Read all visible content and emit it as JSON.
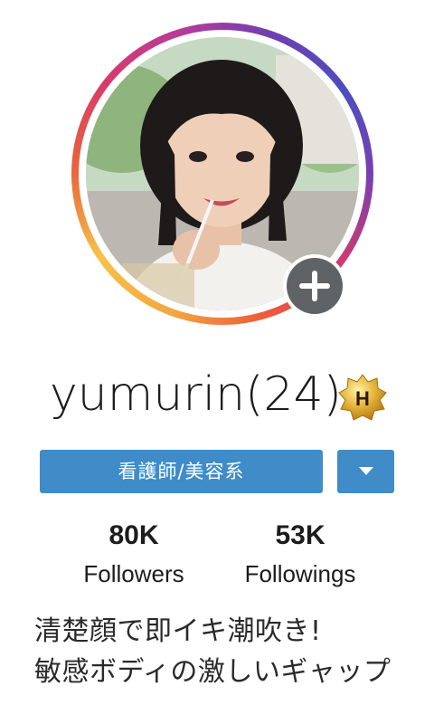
{
  "profile": {
    "username": "yumurin(24)",
    "badge_letter": "H",
    "badge_icon": "gold-star-badge-icon",
    "avatar_icon": "profile-photo",
    "add_icon": "plus-icon"
  },
  "category": {
    "label": "看護師/美容系",
    "dropdown_icon": "caret-down-icon",
    "color": "#3f8cc9"
  },
  "stats": [
    {
      "count": "80K",
      "label": "Followers"
    },
    {
      "count": "53K",
      "label": "Followings"
    }
  ],
  "bio": {
    "lines": [
      "清楚顔で即イキ潮吹き!",
      "敏感ボディの激しいギャップ"
    ]
  }
}
